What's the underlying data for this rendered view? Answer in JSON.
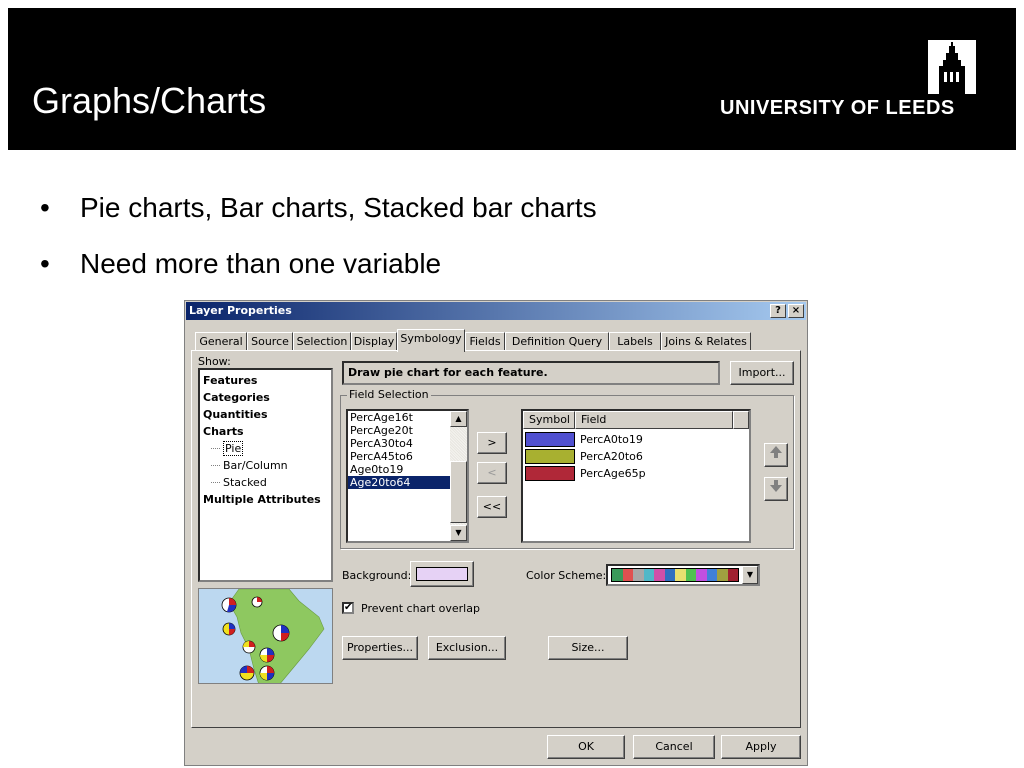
{
  "slide": {
    "title": "Graphs/Charts",
    "university": "UNIVERSITY OF LEEDS",
    "bullets": [
      "Pie charts, Bar charts, Stacked bar charts",
      "Need more than one variable"
    ]
  },
  "dialog": {
    "title": "Layer Properties",
    "help_label": "?",
    "close_label": "×",
    "tabs": [
      {
        "label": "General"
      },
      {
        "label": "Source"
      },
      {
        "label": "Selection"
      },
      {
        "label": "Display"
      },
      {
        "label": "Symbology",
        "active": true
      },
      {
        "label": "Fields"
      },
      {
        "label": "Definition Query"
      },
      {
        "label": "Labels"
      },
      {
        "label": "Joins & Relates"
      }
    ],
    "show_label": "Show:",
    "tree": {
      "features": "Features",
      "categories": "Categories",
      "quantities": "Quantities",
      "charts": "Charts",
      "pie": "Pie",
      "bar": "Bar/Column",
      "stacked": "Stacked",
      "multiple": "Multiple Attributes"
    },
    "description": "Draw pie chart for each feature.",
    "import_label": "Import...",
    "field_selection_label": "Field Selection",
    "available_fields": [
      "PercAge16t",
      "PercAge20t",
      "PercA30to4",
      "PercA45to6",
      "Age0to19",
      "Age20to64"
    ],
    "selected_field_index": 5,
    "move_buttons": {
      "add": ">",
      "remove": "<",
      "remove_all": "<<"
    },
    "symbol_header": "Symbol",
    "field_header": "Field",
    "symbols": [
      {
        "field": "PercA0to19",
        "color": "#5050d0"
      },
      {
        "field": "PercA20to6",
        "color": "#a8b030"
      },
      {
        "field": "PercAge65p",
        "color": "#b02838"
      }
    ],
    "background_label": "Background:",
    "background_color": "#e6d2f5",
    "color_scheme_label": "Color  Scheme:",
    "color_scheme_colors": [
      "#3a9a5a",
      "#e05050",
      "#a8a8a8",
      "#50b8c8",
      "#d050a8",
      "#3070c0",
      "#e8e070",
      "#50c050",
      "#c050e0",
      "#4080d8",
      "#a0a040",
      "#a02030"
    ],
    "prevent_overlap_label": "Prevent chart overlap",
    "prevent_overlap_checked": true,
    "properties_label": "Properties...",
    "exclusion_label": "Exclusion...",
    "size_label": "Size...",
    "ok_label": "OK",
    "cancel_label": "Cancel",
    "apply_label": "Apply",
    "icons": {
      "up": "up-arrow-icon",
      "down": "down-arrow-icon",
      "check": "✔",
      "scroll_up": "▲",
      "scroll_down": "▼",
      "combo": "▼"
    }
  }
}
